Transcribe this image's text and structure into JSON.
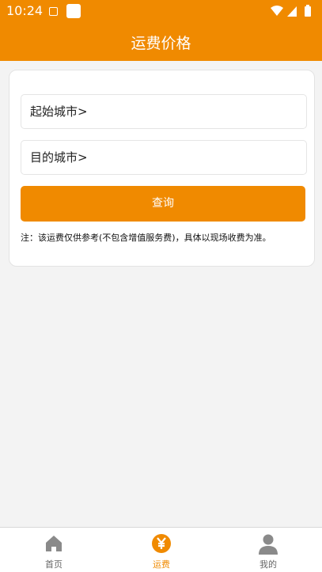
{
  "status_bar": {
    "time": "10:24"
  },
  "header": {
    "title": "运费价格"
  },
  "form": {
    "origin_city": "起始城市>",
    "destination_city": "目的城市>",
    "query_button": "查询",
    "note": "注：该运费仅供参考(不包含增值服务费)，具体以现场收费为准。"
  },
  "tabbar": {
    "tabs": [
      {
        "label": "首页",
        "icon": "home-icon",
        "active": false
      },
      {
        "label": "运费",
        "icon": "yen-icon",
        "active": true
      },
      {
        "label": "我的",
        "icon": "user-icon",
        "active": false
      }
    ]
  },
  "colors": {
    "accent": "#f08a00",
    "background": "#f3f3f3",
    "inactive_icon": "#8a8a8a"
  }
}
